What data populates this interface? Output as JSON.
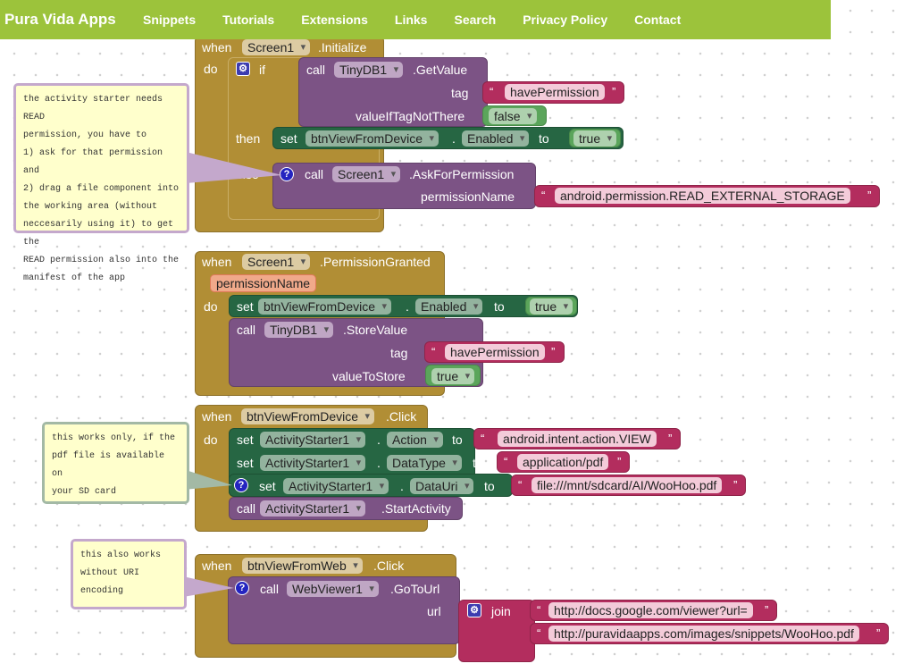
{
  "nav": {
    "brand": "Pura Vida Apps",
    "links": [
      "Snippets",
      "Tutorials",
      "Extensions",
      "Links",
      "Search",
      "Privacy Policy",
      "Contact"
    ],
    "color": "#9cc33b"
  },
  "colors": {
    "event": "#b18e35",
    "procedure": "#7c5385",
    "setter": "#266643",
    "logic": "#5ba55b",
    "text": "#b32d5e"
  },
  "kw": {
    "when": "when",
    "do": "do",
    "if": "if",
    "then": "then",
    "else": "else",
    "call": "call",
    "set": "set",
    "to": "to",
    "join": "join",
    "dot": "."
  },
  "b1": {
    "component": "Screen1",
    "event": ".Initialize",
    "get_comp": "TinyDB1",
    "get_method": ".GetValue",
    "tag_label": "tag",
    "tag_value": "havePermission",
    "default_label": "valueIfTagNotThere",
    "default_value": "false",
    "set_comp": "btnViewFromDevice",
    "set_prop": "Enabled",
    "set_value": "true",
    "ask_comp": "Screen1",
    "ask_method": ".AskForPermission",
    "perm_label": "permissionName",
    "perm_value": "android.permission.READ_EXTERNAL_STORAGE"
  },
  "b2": {
    "component": "Screen1",
    "event": ".PermissionGranted",
    "param": "permissionName",
    "set_comp": "btnViewFromDevice",
    "set_prop": "Enabled",
    "set_value": "true",
    "store_comp": "TinyDB1",
    "store_method": ".StoreValue",
    "tag_label": "tag",
    "tag_value": "havePermission",
    "value_label": "valueToStore",
    "value": "true"
  },
  "b3": {
    "component": "btnViewFromDevice",
    "event": ".Click",
    "comp": "ActivityStarter1",
    "p1": "Action",
    "v1": "android.intent.action.VIEW",
    "p2": "DataType",
    "v2": "application/pdf",
    "p3": "DataUri",
    "v3": "file:///mnt/sdcard/AI/WooHoo.pdf",
    "method": ".StartActivity"
  },
  "b4": {
    "component": "btnViewFromWeb",
    "event": ".Click",
    "comp": "WebViewer1",
    "method": ".GoToUrl",
    "url_label": "url",
    "s1": "http://docs.google.com/viewer?url=",
    "s2": "http://puravidaapps.com/images/snippets/WooHoo.pdf"
  },
  "comments": {
    "c1": [
      "the activity starter needs READ",
      "permission, you have to",
      "1) ask for that permission and",
      "2) drag a file component into",
      "the working area (without",
      "neccesarily using it) to get the",
      "READ permission also into the",
      "manifest of the app"
    ],
    "c2": [
      "this works only, if the",
      "pdf file is available on",
      "your SD card"
    ],
    "c3": [
      "this also works",
      "without URI encoding"
    ]
  }
}
